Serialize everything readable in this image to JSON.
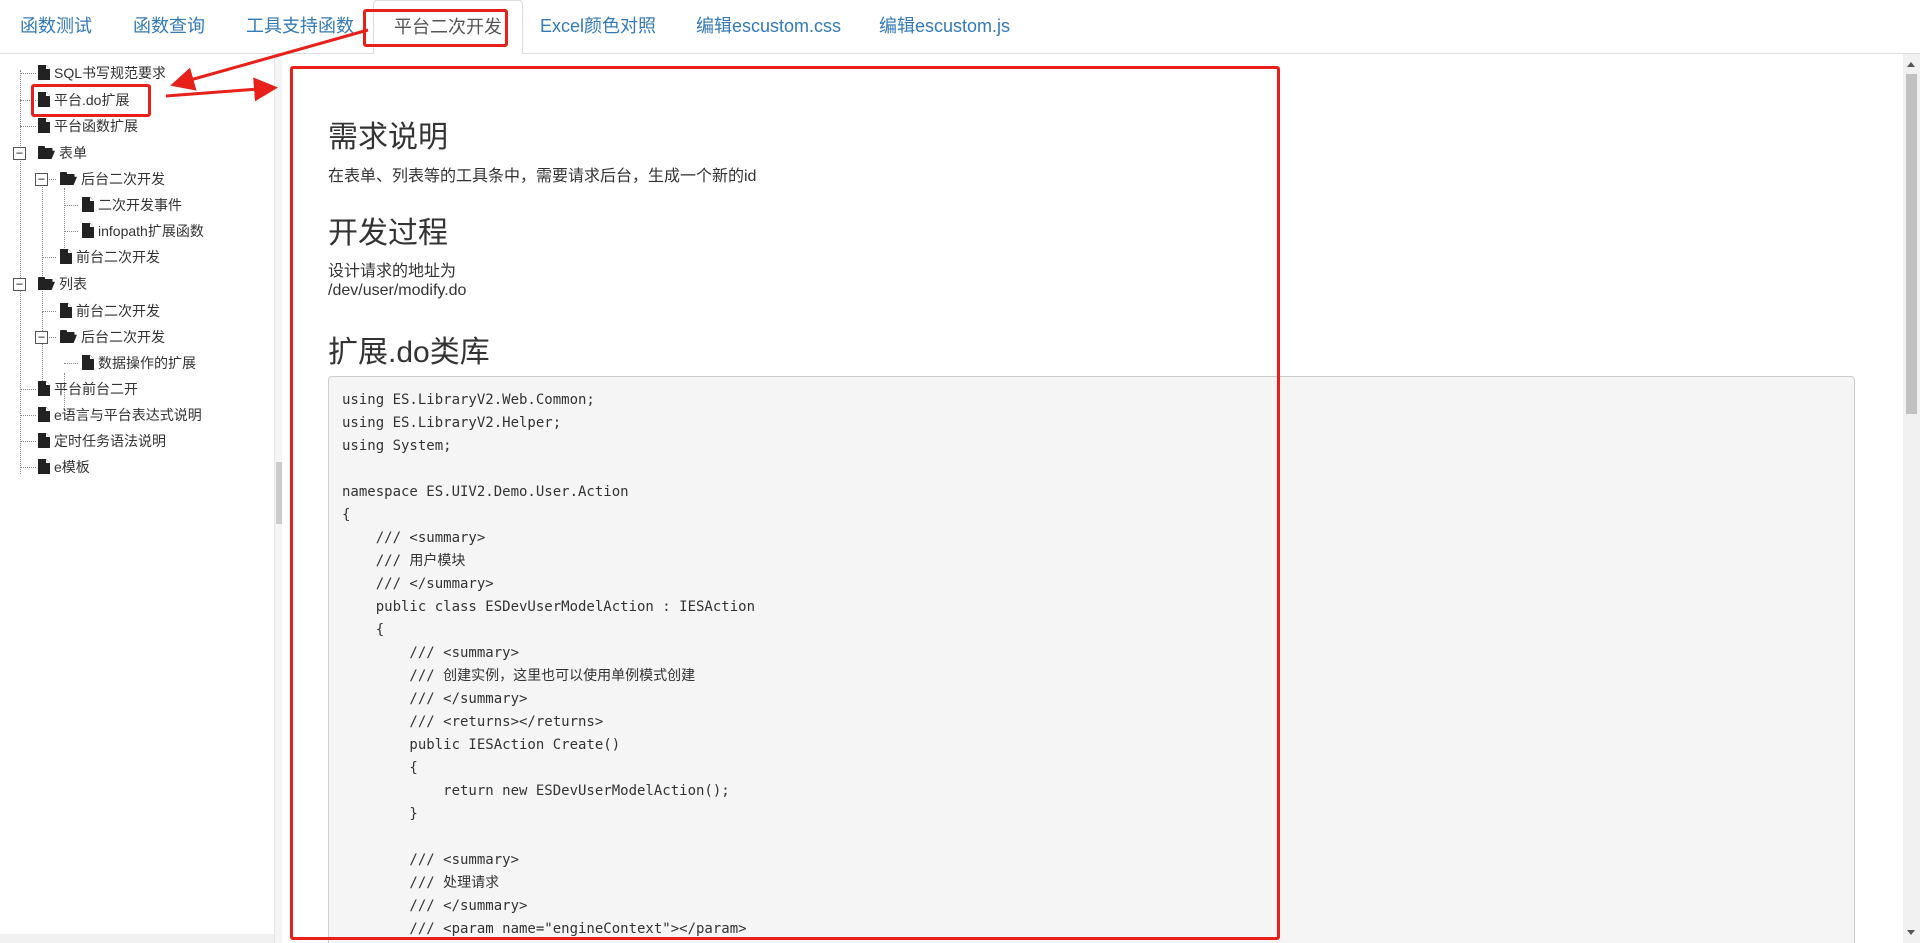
{
  "tabs": [
    {
      "label": "函数测试"
    },
    {
      "label": "函数查询"
    },
    {
      "label": "工具支持函数"
    },
    {
      "label": "平台二次开发"
    },
    {
      "label": "Excel颜色对照"
    },
    {
      "label": "编辑escustom.css"
    },
    {
      "label": "编辑escustom.js"
    }
  ],
  "tree": {
    "items": [
      {
        "label": "SQL书写规范要求"
      },
      {
        "label": "平台.do扩展"
      },
      {
        "label": "平台函数扩展"
      },
      {
        "label": "表单"
      },
      {
        "label": "后台二次开发"
      },
      {
        "label": "二次开发事件"
      },
      {
        "label": "infopath扩展函数"
      },
      {
        "label": "前台二次开发"
      },
      {
        "label": "列表"
      },
      {
        "label": "前台二次开发"
      },
      {
        "label": "后台二次开发"
      },
      {
        "label": "数据操作的扩展"
      },
      {
        "label": "平台前台二开"
      },
      {
        "label": "e语言与平台表达式说明"
      },
      {
        "label": "定时任务语法说明"
      },
      {
        "label": "e模板"
      }
    ],
    "toggle_collapse": "−"
  },
  "content": {
    "h1": "需求说明",
    "p1": "在表单、列表等的工具条中，需要请求后台，生成一个新的id",
    "h2": "开发过程",
    "p2a": "设计请求的地址为",
    "p2b": "/dev/user/modify.do",
    "h3": "扩展.do类库",
    "code_lines": [
      "using ES.LibraryV2.Web.Common;",
      "using ES.LibraryV2.Helper;",
      "using System;",
      "",
      "namespace ES.UIV2.Demo.User.Action",
      "{",
      "    /// <summary>",
      "    /// 用户模块",
      "    /// </summary>",
      "    public class ESDevUserModelAction : IESAction",
      "    {",
      "        /// <summary>",
      "        /// 创建实例，这里也可以使用单例模式创建",
      "        /// </summary>",
      "        /// <returns></returns>",
      "        public IESAction Create()",
      "        {",
      "            return new ESDevUserModelAction();",
      "        }",
      "",
      "        /// <summary>",
      "        /// 处理请求",
      "        /// </summary>",
      "        /// <param name=\"engineContext\"></param>"
    ]
  },
  "colors": {
    "annotation": "#e8201a",
    "link": "#337ab7"
  }
}
